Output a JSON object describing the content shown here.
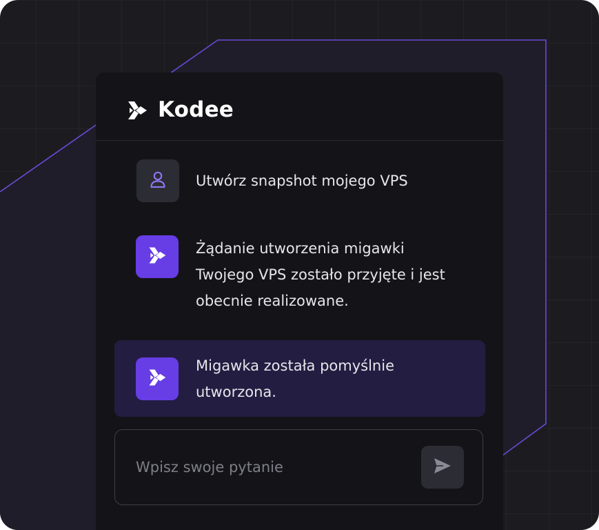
{
  "brand": {
    "name": "Kodee",
    "logo_icon": "kodee-logo-icon"
  },
  "chat": {
    "messages": [
      {
        "role": "user",
        "icon": "user-icon",
        "text": "Utwórz snapshot mojego VPS"
      },
      {
        "role": "assistant",
        "icon": "kodee-logo-icon",
        "text": "Żądanie utworzenia migawki Twojego VPS zostało przyjęte i jest obecnie realizowane."
      },
      {
        "role": "assistant",
        "icon": "kodee-logo-icon",
        "highlighted": true,
        "text": "Migawka została pomyślnie utworzona."
      }
    ]
  },
  "composer": {
    "placeholder": "Wpisz swoje pytanie",
    "send_icon": "send-icon"
  },
  "colors": {
    "background": "#1c1c20",
    "card": "#141418",
    "accent": "#673de6",
    "highlight": "#231d42",
    "accent_line": "#6c4ad8"
  }
}
